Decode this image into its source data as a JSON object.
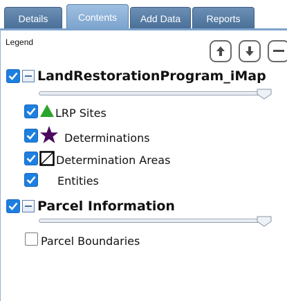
{
  "tabs": [
    {
      "label": "Details",
      "active": false
    },
    {
      "label": "Contents",
      "active": true
    },
    {
      "label": "Add Data",
      "active": false
    },
    {
      "label": "Reports",
      "active": false
    }
  ],
  "legend_label": "Legend",
  "controls": {
    "move_up": "arrow-up-icon",
    "move_down": "arrow-down-icon",
    "collapse_all": "minus-icon"
  },
  "groups": [
    {
      "title": "LandRestorationProgram_iMap",
      "checked": true,
      "expanded": true,
      "transparency_slider_value": 1.0,
      "layers": [
        {
          "label": "LRP Sites",
          "checked": true,
          "symbol": "green-triangle-icon",
          "symbol_color": "#2aa52a"
        },
        {
          "label": "Determinations",
          "checked": true,
          "symbol": "purple-star-icon",
          "symbol_color": "#4a0a5e"
        },
        {
          "label": "Determination Areas",
          "checked": true,
          "symbol": "hatched-square-icon",
          "symbol_color": "#000000"
        },
        {
          "label": "Entities",
          "checked": true,
          "symbol": "",
          "symbol_color": ""
        }
      ]
    },
    {
      "title": "Parcel Information",
      "checked": true,
      "expanded": true,
      "transparency_slider_value": 1.0,
      "layers": [
        {
          "label": "Parcel Boundaries",
          "checked": false,
          "symbol": "",
          "symbol_color": ""
        }
      ]
    }
  ],
  "colors": {
    "tab_bg": "#4a6f98",
    "tab_active_bg": "#7ba3cc",
    "checkbox": "#1e7fe0"
  }
}
